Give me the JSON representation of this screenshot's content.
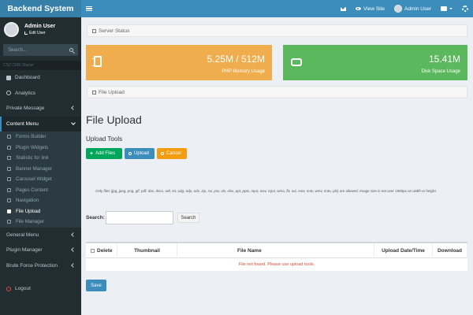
{
  "app": {
    "title": "Backend System"
  },
  "topbar": {
    "view_site": "View Site",
    "user": "Admin User"
  },
  "sidebar": {
    "user_name": "Admin User",
    "edit_user": "Edit User",
    "search_placeholder": "Search...",
    "section_header": "CSZ CMS Starter",
    "items": [
      {
        "label": "Dashboard"
      },
      {
        "label": "Analytics"
      },
      {
        "label": "Private Message"
      },
      {
        "label": "Content Menu"
      }
    ],
    "submenu": [
      {
        "label": "Forms Builder"
      },
      {
        "label": "Plugin Widgets"
      },
      {
        "label": "Statistic for link"
      },
      {
        "label": "Banner Manager"
      },
      {
        "label": "Carousel Widget"
      },
      {
        "label": "Pages Content"
      },
      {
        "label": "Navigation"
      },
      {
        "label": "File Upload"
      },
      {
        "label": "File Manager"
      }
    ],
    "items_after": [
      {
        "label": "General Menu"
      },
      {
        "label": "Plugin Manager"
      },
      {
        "label": "Brute Force Protection"
      }
    ],
    "logout": "Logout"
  },
  "breadcrumb_top": "Server Status",
  "stats": {
    "memory_value": "5.25M / 512M",
    "memory_label": "PHP Memory Usage",
    "disk_value": "15.41M",
    "disk_label": "Disk Space Usage"
  },
  "breadcrumb_page": "File Upload",
  "page": {
    "title": "File Upload",
    "tools_title": "Upload Tools",
    "add_files": "Add Files",
    "upload": "Upload",
    "cancel": "Cancel",
    "note": "Only files (jpg, jpeg, png, gif, pdf, doc, docx, odt, txt, odg, odp, ods, zip, rar, psv, xls, xlsx, ppt, pptx, mp3, wav, mp4, wma, flv, avi, mov, m4v, wmv, m3u, pls) are allowed. Image size is not over 1900px on width or height.",
    "search_label": "Search:",
    "search_button": "Search",
    "table_headers": [
      "Delete",
      "Thumbnail",
      "File Name",
      "Upload Date/Time",
      "Download"
    ],
    "empty_message": "File not found. Please use upload tools.",
    "save": "Save"
  },
  "colors": {
    "header": "#3c8dbc",
    "sidebar": "#222d32",
    "memory_box": "#f0ad4e",
    "disk_box": "#5cb85c"
  }
}
